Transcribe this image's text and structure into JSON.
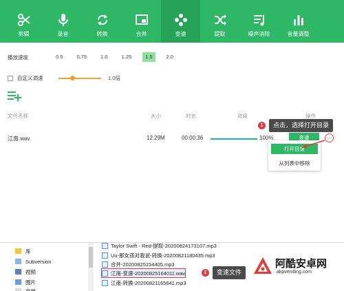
{
  "toolbar": {
    "accent": "#2eb865",
    "tools": [
      {
        "label": "剪辑",
        "icon": "scissors-icon"
      },
      {
        "label": "录音",
        "icon": "microphone-icon"
      },
      {
        "label": "转换",
        "icon": "convert-icon"
      },
      {
        "label": "合并",
        "icon": "merge-icon"
      },
      {
        "label": "变速",
        "icon": "speed-icon",
        "active": true
      },
      {
        "label": "提取",
        "icon": "extract-icon"
      },
      {
        "label": "噪声消除",
        "icon": "noise-icon"
      },
      {
        "label": "音量调整",
        "icon": "volume-icon"
      }
    ]
  },
  "speed": {
    "label": "播放速度",
    "options": [
      "0.5",
      "0.75",
      "1.0",
      "1.25",
      "1.5",
      "2.0"
    ],
    "selected": "1.5",
    "selected_color": "#8fdf9e"
  },
  "custom_speed": {
    "label": "自定义调速",
    "checked": false,
    "value_text": "1.0倍",
    "slider_fraction": 0.33
  },
  "table": {
    "headers": {
      "name": "文件名称",
      "size": "大小",
      "duration": "时长",
      "progress": "进度",
      "action": "操作"
    },
    "rows": [
      {
        "name": "江南.wav",
        "size": "12.29M",
        "duration": "00:00:36",
        "progress_text": "100%",
        "progress": 1.0,
        "action_label": "变速"
      }
    ]
  },
  "context_menu": {
    "open_dir": "打开目录",
    "remove": "从列表中移除"
  },
  "callouts": {
    "step1_num": "1",
    "step1_text": "点击，选择打开目录",
    "step2_num": "2",
    "step2_text": "变速文件"
  },
  "explorer": {
    "tree": [
      {
        "label": "库"
      },
      {
        "label": "Subversion"
      },
      {
        "label": "视频"
      },
      {
        "label": "图片"
      },
      {
        "label": "文档"
      }
    ],
    "files": [
      {
        "name": "Taylor Swift - Red-提取-20200824173107.mp3"
      },
      {
        "name": "Uu-那女孩对我说-转换-20200821180435.mp3"
      },
      {
        "name": "合并-20200825154405.mp3"
      },
      {
        "name": "江南-变速-20200825164011.wav",
        "highlight": true
      },
      {
        "name": "江南-转换-20200821165641.mp3"
      }
    ]
  },
  "watermark": {
    "title": "阿酷安卓网",
    "url": "akpvending.com"
  }
}
